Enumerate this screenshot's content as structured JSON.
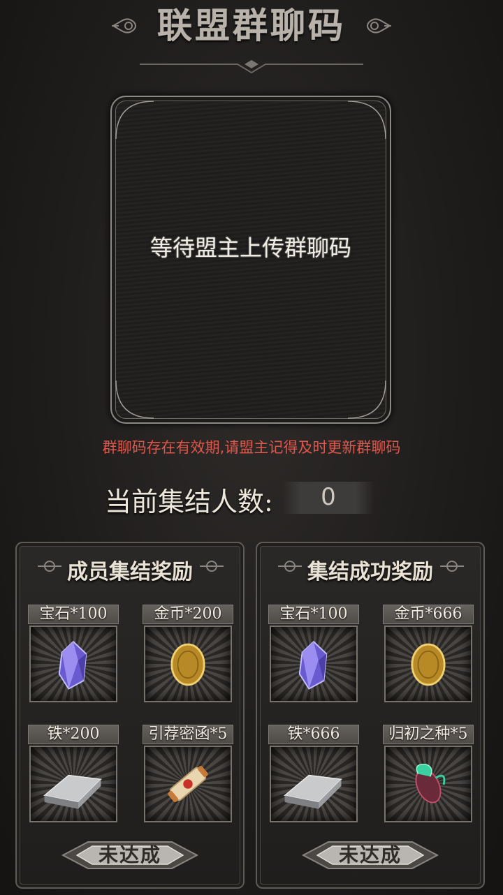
{
  "header": {
    "title": "联盟群聊码"
  },
  "qr": {
    "placeholder_text": "等待盟主上传群聊码"
  },
  "notice": {
    "text": "群聊码存在有效期,请盟主记得及时更新群聊码"
  },
  "gather": {
    "label": "当前集结人数:",
    "count": "0"
  },
  "panels": [
    {
      "title": "成员集结奖励",
      "items": [
        {
          "label": "宝石*100",
          "icon": "gem-icon"
        },
        {
          "label": "金币*200",
          "icon": "gold-coin-icon"
        },
        {
          "label": "铁*200",
          "icon": "iron-ingot-icon"
        },
        {
          "label": "引荐密函*5",
          "icon": "scroll-icon"
        }
      ],
      "button": "未达成"
    },
    {
      "title": "集结成功奖励",
      "items": [
        {
          "label": "宝石*100",
          "icon": "gem-icon"
        },
        {
          "label": "金币*666",
          "icon": "gold-coin-icon"
        },
        {
          "label": "铁*666",
          "icon": "iron-ingot-icon"
        },
        {
          "label": "归初之种*5",
          "icon": "seed-icon"
        }
      ],
      "button": "未达成"
    }
  ],
  "colors": {
    "warning": "#e0574c",
    "text": "#e8e2d6",
    "gold": "#d4a93a",
    "gem": "#7b6ad8"
  }
}
